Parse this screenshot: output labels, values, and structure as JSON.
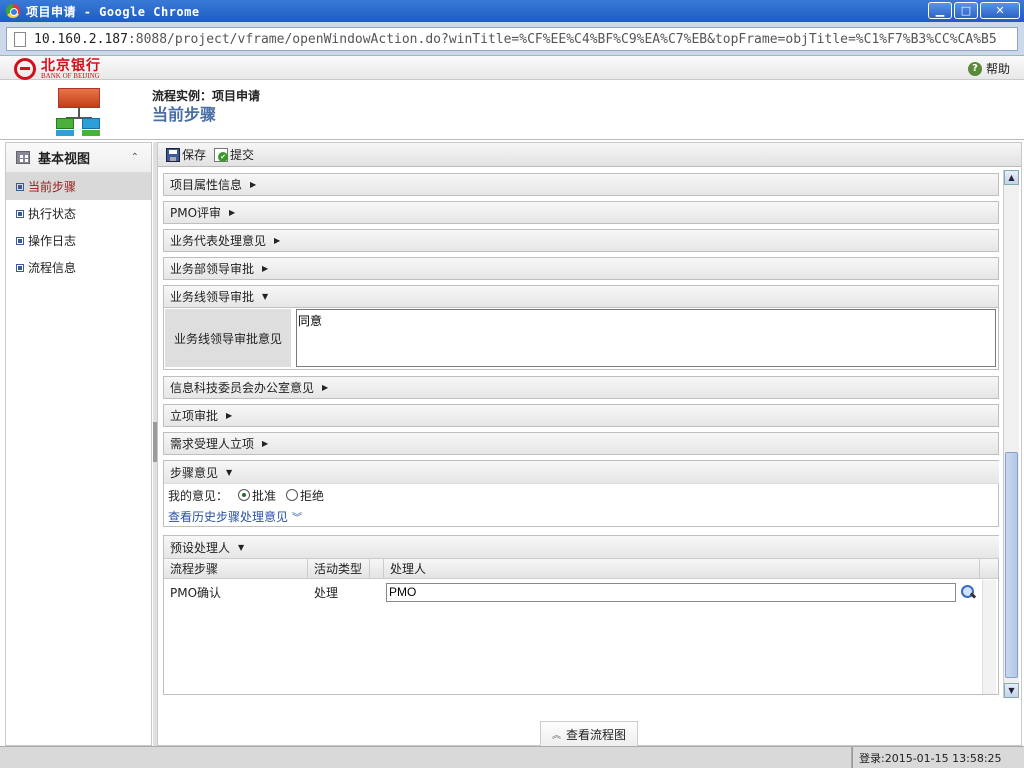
{
  "window": {
    "title": "项目申请 - Google Chrome",
    "controls": {
      "minimize": "▁",
      "maximize": "□",
      "close": "✕"
    }
  },
  "address_bar": {
    "host": "10.160.2.187",
    "rest": ":8088/project/vframe/openWindowAction.do?winTitle=%CF%EE%C4%BF%C9%EA%C7%EB&topFrame=objTitle=%C1%F7%B3%CC%CA%B5"
  },
  "bank": {
    "name_cn": "北京银行",
    "name_en": "BANK OF BEIJING"
  },
  "help_label": "帮助",
  "process": {
    "instance_label": "流程实例：项目申请",
    "current_step_label": "当前步骤"
  },
  "sidebar": {
    "title": "基本视图",
    "items": [
      {
        "label": "当前步骤",
        "active": true
      },
      {
        "label": "执行状态",
        "active": false
      },
      {
        "label": "操作日志",
        "active": false
      },
      {
        "label": "流程信息",
        "active": false
      }
    ]
  },
  "toolbar": {
    "save_label": "保存",
    "submit_label": "提交"
  },
  "sections": [
    {
      "label": "项目属性信息",
      "expanded": false
    },
    {
      "label": "PMO评审",
      "expanded": false
    },
    {
      "label": "业务代表处理意见",
      "expanded": false
    },
    {
      "label": "业务部领导审批",
      "expanded": false
    },
    {
      "label": "业务线领导审批",
      "expanded": true
    },
    {
      "label": "信息科技委员会办公室意见",
      "expanded": false
    },
    {
      "label": "立项审批",
      "expanded": false
    },
    {
      "label": "需求受理人立项",
      "expanded": false
    }
  ],
  "business_line_opinion": {
    "label": "业务线领导审批意见",
    "value": "同意"
  },
  "step_opinion": {
    "title": "步骤意见",
    "my_opinion_label": "我的意见：",
    "options": [
      {
        "label": "批准",
        "checked": true
      },
      {
        "label": "拒绝",
        "checked": false
      }
    ],
    "history_link": "查看历史步骤处理意见"
  },
  "preset_handler": {
    "title": "预设处理人",
    "columns": [
      "流程步骤",
      "活动类型",
      "处理人"
    ],
    "rows": [
      {
        "step": "PMO确认",
        "activity": "处理",
        "handler": "PMO"
      }
    ]
  },
  "view_flow_label": "查看流程图",
  "status": {
    "login_time": "登录:2015-01-15 13:58:25"
  },
  "icons": {
    "arrow_right": "▶",
    "arrow_down": "▼",
    "expand_double": "»",
    "up_double": "«"
  },
  "colors": {
    "brand": "#d0101b",
    "active_item": "#9a1a1a",
    "link": "#2a52a0"
  }
}
